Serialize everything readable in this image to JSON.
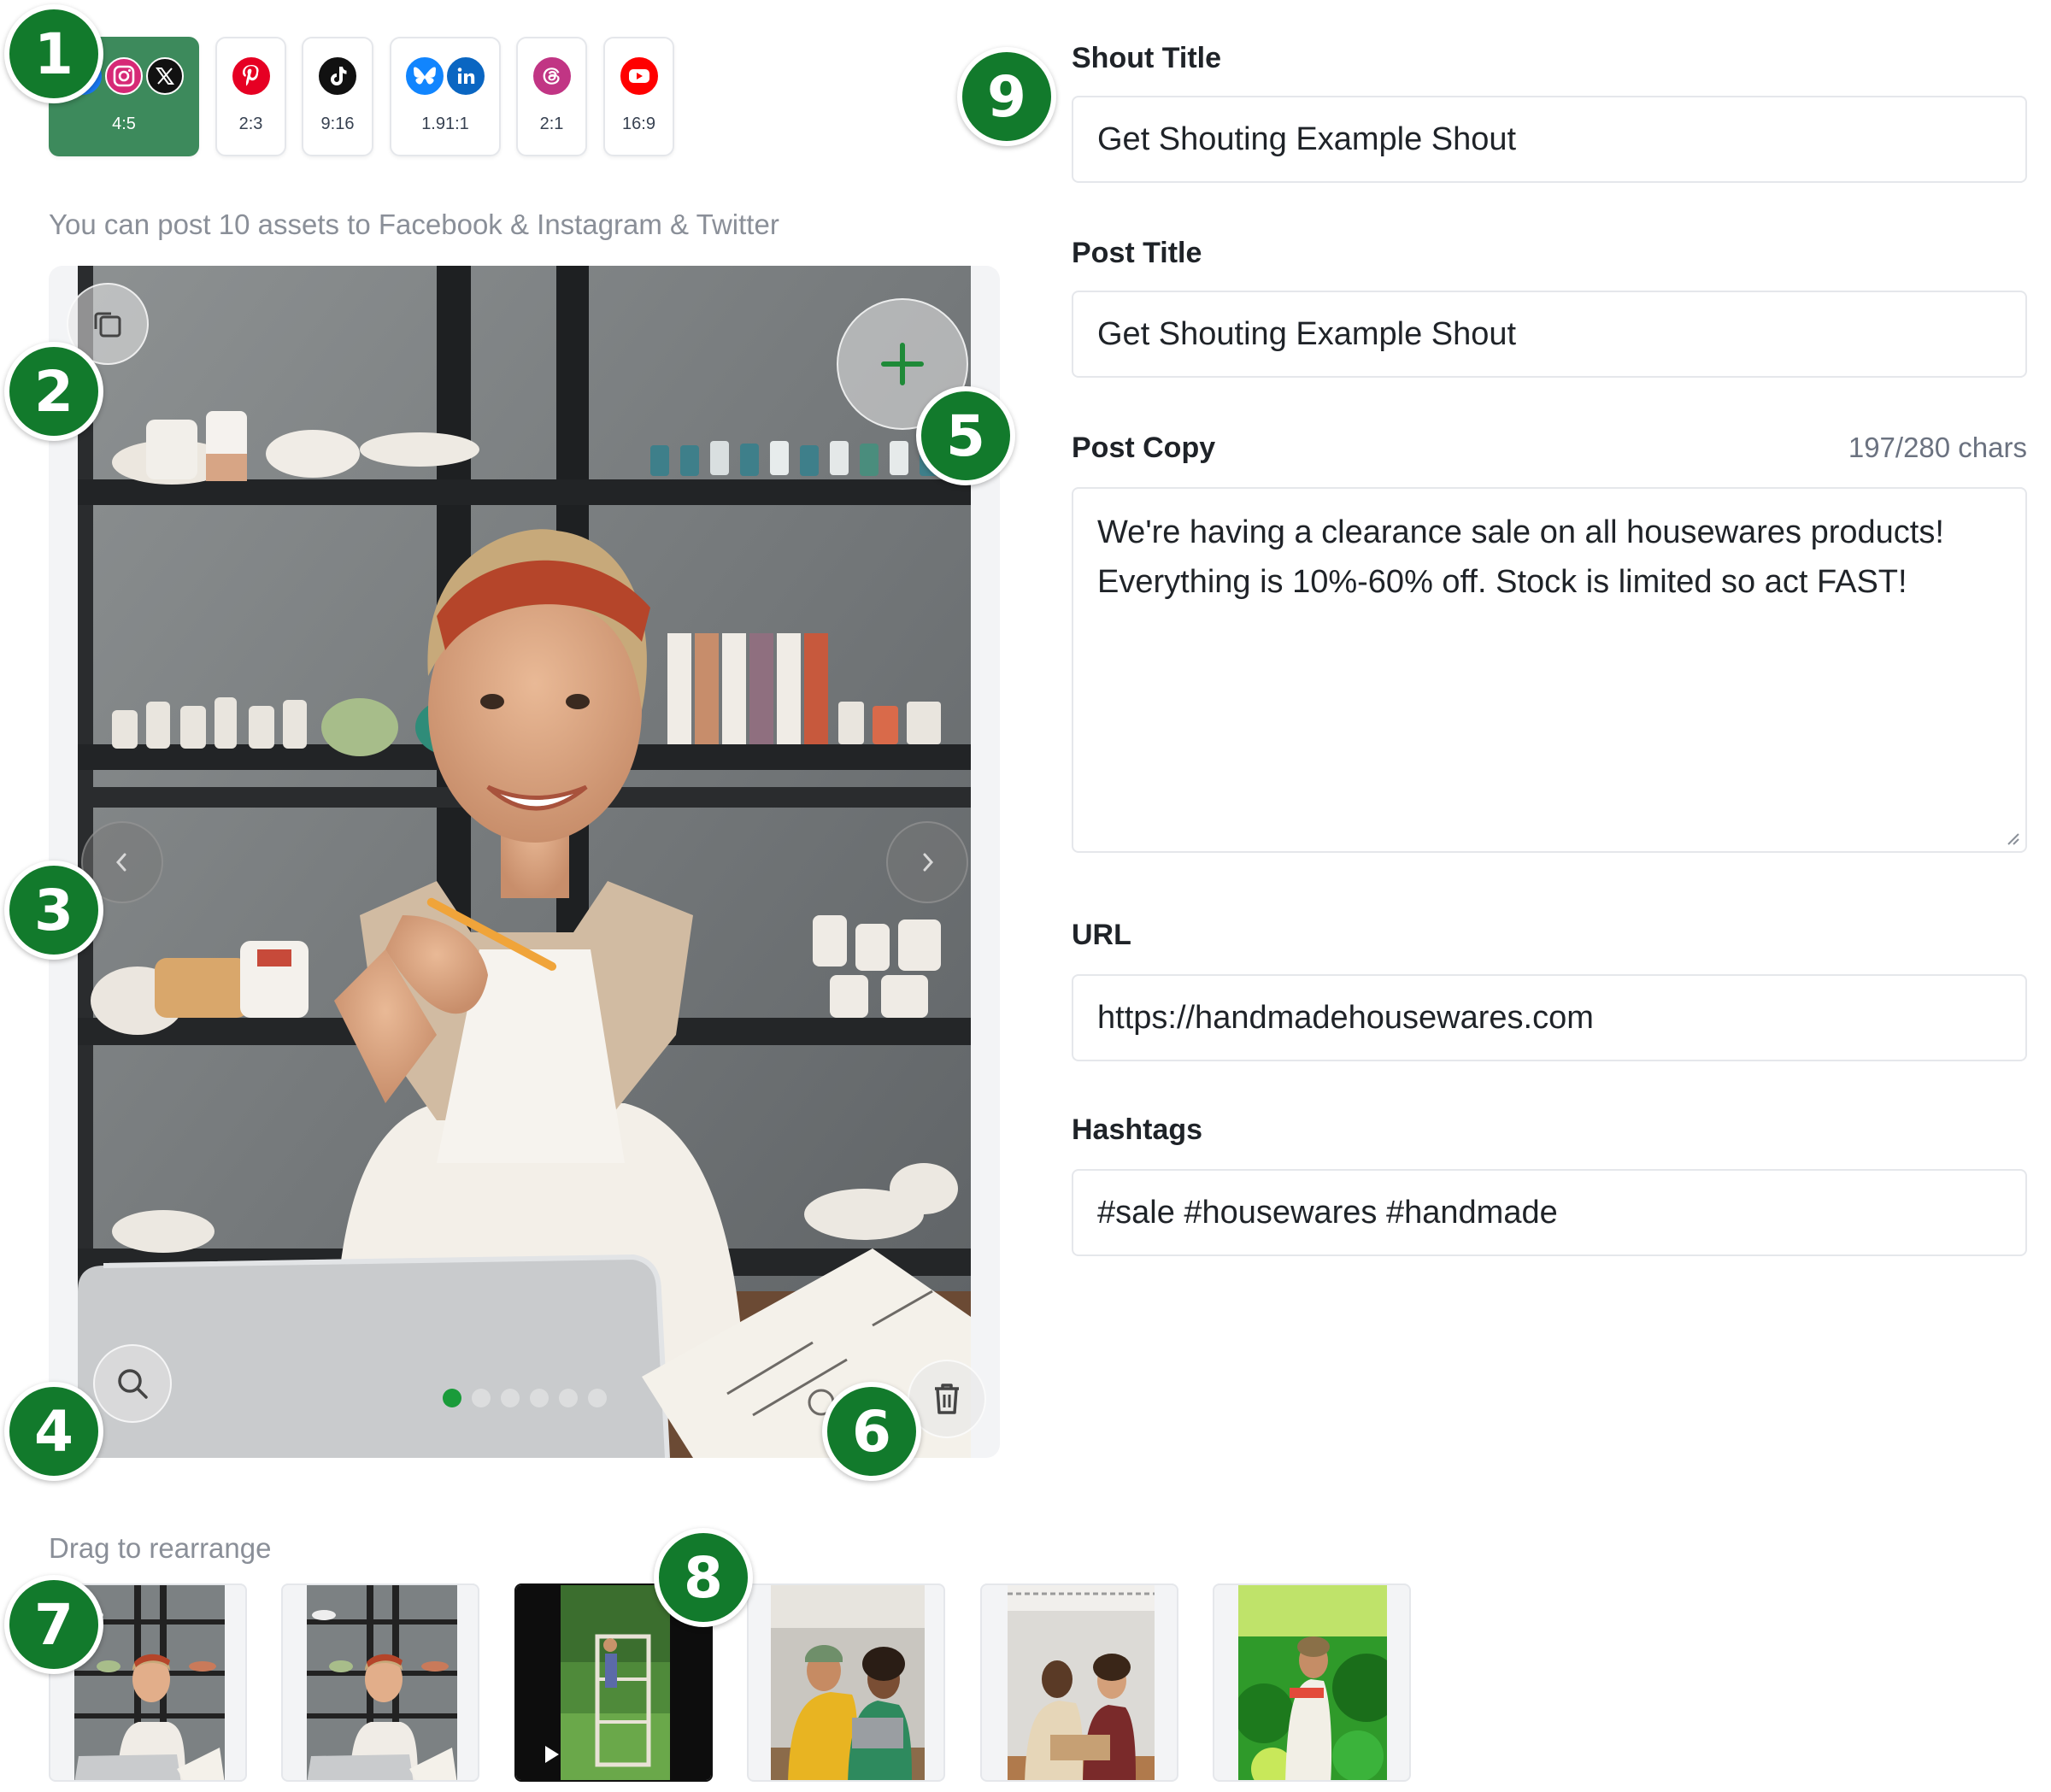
{
  "ratio_tabs": [
    {
      "ratio": "4:5",
      "icons": [
        "facebook-icon",
        "instagram-icon",
        "x-icon"
      ],
      "active": true
    },
    {
      "ratio": "2:3",
      "icons": [
        "pinterest-icon"
      ],
      "active": false
    },
    {
      "ratio": "9:16",
      "icons": [
        "tiktok-icon"
      ],
      "active": false
    },
    {
      "ratio": "1.91:1",
      "icons": [
        "bluesky-icon",
        "linkedin-icon"
      ],
      "active": false
    },
    {
      "ratio": "2:1",
      "icons": [
        "threads-icon"
      ],
      "active": false
    },
    {
      "ratio": "16:9",
      "icons": [
        "youtube-icon"
      ],
      "active": false
    }
  ],
  "asset_hint": "You can post 10 assets to Facebook & Instagram & Twitter",
  "preview": {
    "carousel": {
      "total": 6,
      "current": 1
    },
    "icons": {
      "duplicate": "duplicate-icon",
      "add": "plus-icon",
      "prev": "chevron-left-icon",
      "next": "chevron-right-icon",
      "zoom": "zoom-icon",
      "delete": "trash-icon"
    }
  },
  "rearrange_hint": "Drag to rearrange",
  "thumbnails": [
    {
      "kind": "image",
      "scene": "woman-at-laptop"
    },
    {
      "kind": "image",
      "scene": "woman-at-laptop"
    },
    {
      "kind": "video",
      "scene": "garden-frame"
    },
    {
      "kind": "image",
      "scene": "couple-with-laptop"
    },
    {
      "kind": "image",
      "scene": "couple-in-workshop"
    },
    {
      "kind": "image",
      "scene": "gardener"
    }
  ],
  "markers": [
    "1",
    "2",
    "3",
    "4",
    "5",
    "6",
    "7",
    "8",
    "9"
  ],
  "form": {
    "shout_title": {
      "label": "Shout Title",
      "value": "Get Shouting Example Shout"
    },
    "post_title": {
      "label": "Post Title",
      "value": "Get Shouting Example Shout"
    },
    "post_copy": {
      "label": "Post Copy",
      "count": "197/280 chars",
      "value": "We're having a clearance sale on all housewares products! Everything is 10%-60% off. Stock is limited so act FAST!"
    },
    "url": {
      "label": "URL",
      "value": "https://handmadehousewares.com"
    },
    "hashtags": {
      "label": "Hashtags",
      "value": "#sale #housewares #handmade"
    }
  },
  "colors": {
    "accent": "#3d8a5c",
    "marker": "#127a2c",
    "active_dot": "#1a9b3a"
  }
}
